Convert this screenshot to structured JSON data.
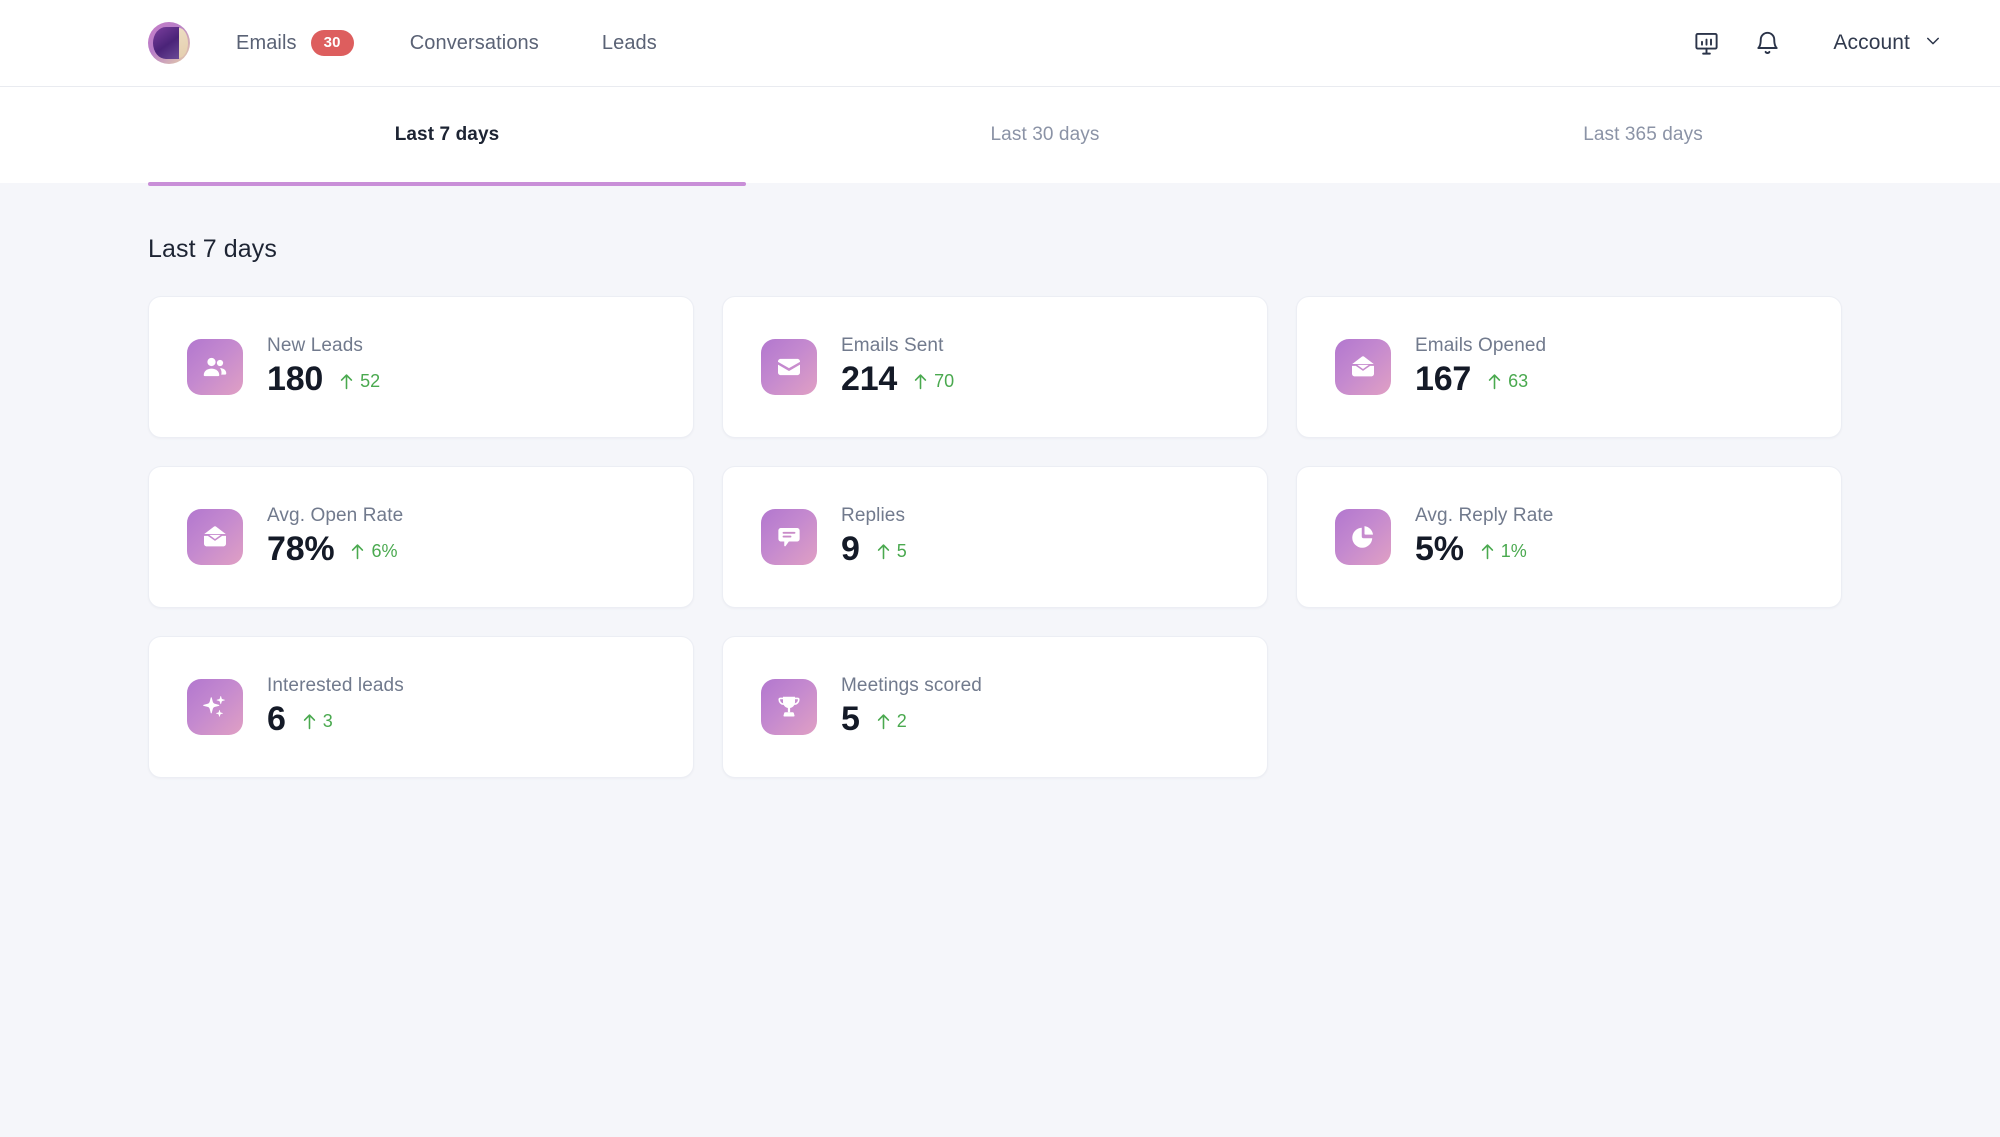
{
  "nav": {
    "logo_icon": "brand-logo-icon",
    "items": [
      {
        "label": "Emails",
        "badge": "30"
      },
      {
        "label": "Conversations"
      },
      {
        "label": "Leads"
      }
    ],
    "emails_label": "Emails",
    "emails_badge": "30",
    "conversations_label": "Conversations",
    "leads_label": "Leads",
    "reports_icon": "presentation-chart-icon",
    "notifications_icon": "bell-icon",
    "account_label": "Account",
    "account_chevron_icon": "chevron-down-icon",
    "badge_color": "#dd5e5e"
  },
  "tabs": {
    "active_index": 0,
    "active_underline_color": "#c98fd8",
    "items": [
      {
        "label": "Last 7 days"
      },
      {
        "label": "Last 30 days"
      },
      {
        "label": "Last 365 days"
      }
    ]
  },
  "main": {
    "section_title": "Last 7 days",
    "delta_color": "#4aa94f",
    "tile_gradient_from": "#b277cf",
    "tile_gradient_to": "#e0a0c4",
    "cards": [
      {
        "label": "New Leads",
        "value": "180",
        "delta": "52",
        "delta_direction": "up",
        "icon": "users-icon"
      },
      {
        "label": "Emails Sent",
        "value": "214",
        "delta": "70",
        "delta_direction": "up",
        "icon": "envelope-closed-icon"
      },
      {
        "label": "Emails Opened",
        "value": "167",
        "delta": "63",
        "delta_direction": "up",
        "icon": "envelope-open-icon"
      },
      {
        "label": "Avg. Open Rate",
        "value": "78%",
        "delta": "6%",
        "delta_direction": "up",
        "icon": "envelope-open-icon"
      },
      {
        "label": "Replies",
        "value": "9",
        "delta": "5",
        "delta_direction": "up",
        "icon": "chat-bubble-icon"
      },
      {
        "label": "Avg. Reply Rate",
        "value": "5%",
        "delta": "1%",
        "delta_direction": "up",
        "icon": "pie-chart-icon"
      },
      {
        "label": "Interested leads",
        "value": "6",
        "delta": "3",
        "delta_direction": "up",
        "icon": "sparkles-icon"
      },
      {
        "label": "Meetings scored",
        "value": "5",
        "delta": "2",
        "delta_direction": "up",
        "icon": "trophy-icon"
      }
    ]
  }
}
